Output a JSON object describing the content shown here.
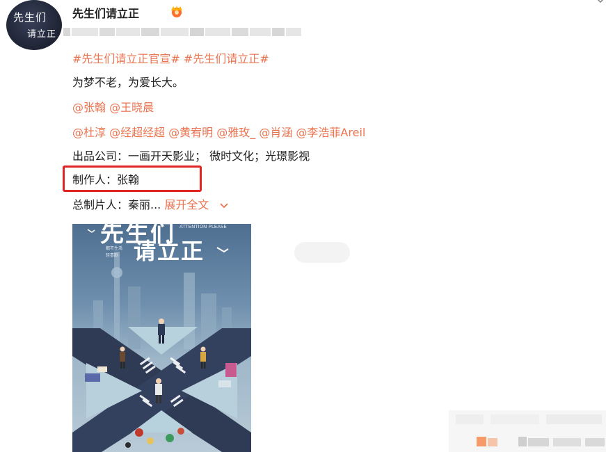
{
  "post": {
    "avatar_text_line1": "先生们",
    "avatar_text_line2": "请立正",
    "username": "先生们请立正",
    "hashtags": "#先生们请立正官宣# #先生们请立正#",
    "slogan": "为梦不老，为爱长大。",
    "mentions_line1": "@张翰 @王晓晨",
    "mentions_line2": "@杜淳 @经超经超 @黄宥明 @雅玫_ @肖涵 @李浩菲Areil",
    "company_line": "出品公司：一画开天影业； 微时文化；光璟影视",
    "producer_line": "制作人：张翰",
    "chief_producer_prefix": "总制片人：秦丽...",
    "expand_label": "展开全文"
  },
  "poster": {
    "title_line1": "先生们",
    "title_line2": "请立正",
    "english_title": "ATTENTION PLEASE",
    "small_text1": "都市生活",
    "small_text2": "轻喜剧"
  },
  "colors": {
    "link": "#eb7350",
    "highlight_box": "#e02424",
    "text": "#222222"
  }
}
